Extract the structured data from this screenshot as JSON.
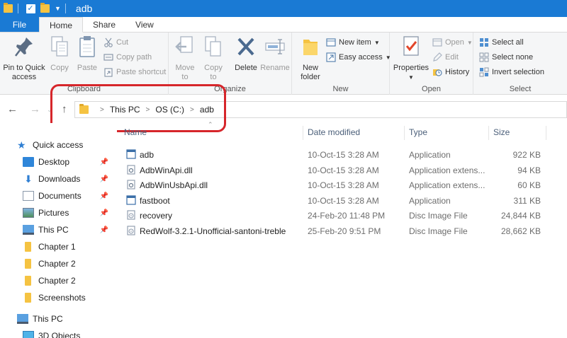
{
  "window": {
    "title": "adb"
  },
  "tabs": {
    "file": "File",
    "home": "Home",
    "share": "Share",
    "view": "View"
  },
  "ribbon": {
    "clipboard": {
      "label": "Clipboard",
      "pin_line1": "Pin to Quick",
      "pin_line2": "access",
      "copy": "Copy",
      "paste": "Paste",
      "cut": "Cut",
      "copy_path": "Copy path",
      "paste_shortcut": "Paste shortcut"
    },
    "organize": {
      "label": "Organize",
      "move_line1": "Move",
      "move_line2": "to",
      "copy_line1": "Copy",
      "copy_line2": "to",
      "delete": "Delete",
      "rename": "Rename"
    },
    "new": {
      "label": "New",
      "folder_line1": "New",
      "folder_line2": "folder",
      "new_item": "New item",
      "easy_access": "Easy access"
    },
    "open": {
      "label": "Open",
      "properties": "Properties",
      "open": "Open",
      "edit": "Edit",
      "history": "History"
    },
    "select": {
      "label": "Select",
      "select_all": "Select all",
      "select_none": "Select none",
      "invert": "Invert selection"
    }
  },
  "address": {
    "crumbs": [
      "This PC",
      "OS (C:)",
      "adb"
    ]
  },
  "nav": {
    "quick_access": "Quick access",
    "items": [
      "Desktop",
      "Downloads",
      "Documents",
      "Pictures",
      "This PC",
      "Chapter 1",
      "Chapter 2",
      "Chapter 2",
      "Screenshots"
    ],
    "this_pc": "This PC",
    "objects_3d": "3D Objects"
  },
  "columns": {
    "name": "Name",
    "date": "Date modified",
    "type": "Type",
    "size": "Size"
  },
  "files": [
    {
      "name": "adb",
      "date": "10-Oct-15 3:28 AM",
      "type": "Application",
      "size": "922 KB",
      "icon": "exe"
    },
    {
      "name": "AdbWinApi.dll",
      "date": "10-Oct-15 3:28 AM",
      "type": "Application extens...",
      "size": "94 KB",
      "icon": "dll"
    },
    {
      "name": "AdbWinUsbApi.dll",
      "date": "10-Oct-15 3:28 AM",
      "type": "Application extens...",
      "size": "60 KB",
      "icon": "dll"
    },
    {
      "name": "fastboot",
      "date": "10-Oct-15 3:28 AM",
      "type": "Application",
      "size": "311 KB",
      "icon": "exe"
    },
    {
      "name": "recovery",
      "date": "24-Feb-20 11:48 PM",
      "type": "Disc Image File",
      "size": "24,844 KB",
      "icon": "img"
    },
    {
      "name": "RedWolf-3.2.1-Unofficial-santoni-treble",
      "date": "25-Feb-20 9:51 PM",
      "type": "Disc Image File",
      "size": "28,662 KB",
      "icon": "img"
    }
  ],
  "colors": {
    "accent": "#1a7ad4",
    "highlight": "#d6262b",
    "folder": "#f5c342"
  }
}
